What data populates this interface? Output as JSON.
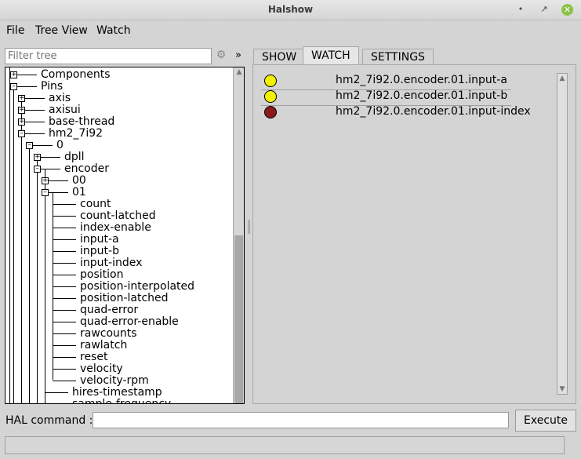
{
  "window": {
    "title": "Halshow"
  },
  "menu": {
    "file": "File",
    "tree_view": "Tree View",
    "watch": "Watch"
  },
  "filter": {
    "placeholder": "Filter tree",
    "expand_glyph": "»"
  },
  "tree": {
    "items": [
      "Components",
      "Pins",
      "axis",
      "axisui",
      "base-thread",
      "hm2_7i92",
      "0",
      "dpll",
      "encoder",
      "00",
      "01",
      "count",
      "count-latched",
      "index-enable",
      "input-a",
      "input-b",
      "input-index",
      "position",
      "position-interpolated",
      "position-latched",
      "quad-error",
      "quad-error-enable",
      "rawcounts",
      "rawlatch",
      "reset",
      "velocity",
      "velocity-rpm",
      "hires-timestamp",
      "sample-frequency"
    ]
  },
  "tabs": {
    "show": "SHOW",
    "watch": "WATCH",
    "settings": "SETTINGS"
  },
  "watch": {
    "items": [
      {
        "name": "hm2_7i92.0.encoder.01.input-a",
        "color": "#f2f200"
      },
      {
        "name": "hm2_7i92.0.encoder.01.input-b",
        "color": "#f2f200"
      },
      {
        "name": "hm2_7i92.0.encoder.01.input-index",
        "color": "#8b1a1a"
      }
    ]
  },
  "command": {
    "label": "HAL command :",
    "value": "",
    "execute": "Execute"
  }
}
